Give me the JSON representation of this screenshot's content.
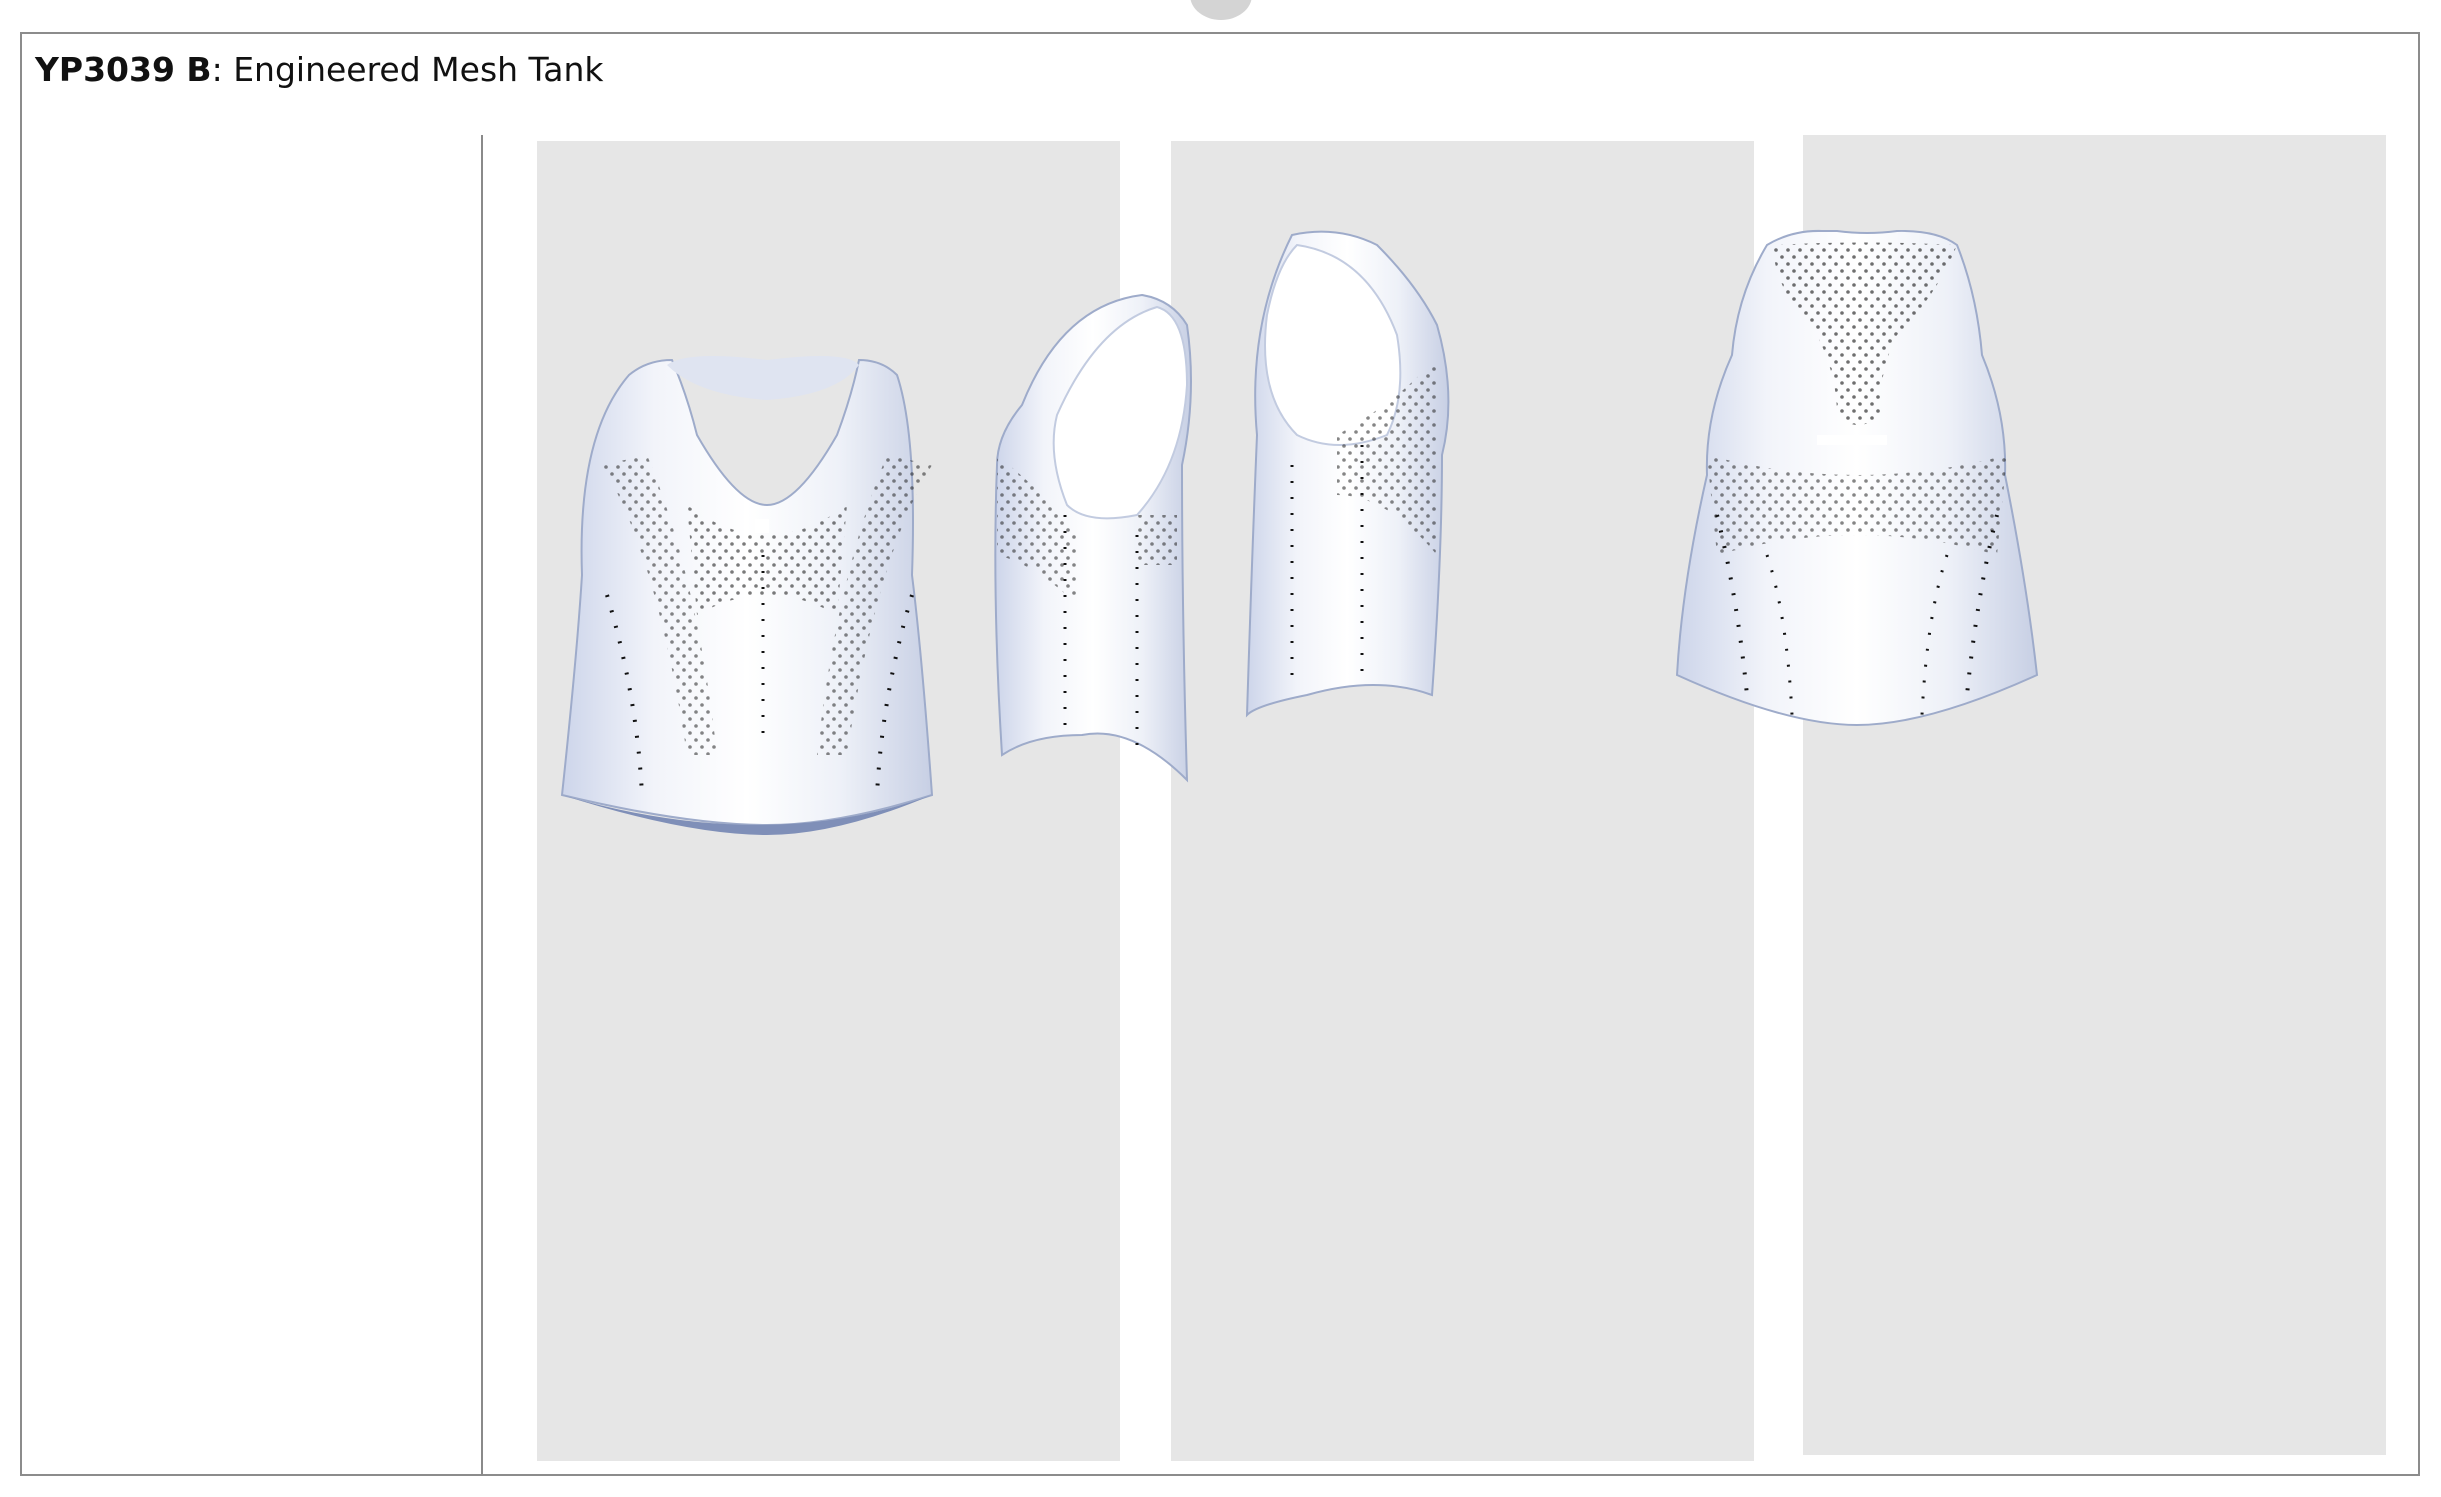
{
  "document": {
    "style_code": "YP3039 B",
    "separator": ":",
    "style_name": " Engineered Mesh Tank"
  },
  "views": [
    "front",
    "side-right",
    "side-left",
    "back"
  ],
  "colors": {
    "panel": "#e6e6e6",
    "garment": "#f4f6fb",
    "garment_shadow": "#c9d1e6",
    "mesh_dots": "#111111"
  }
}
